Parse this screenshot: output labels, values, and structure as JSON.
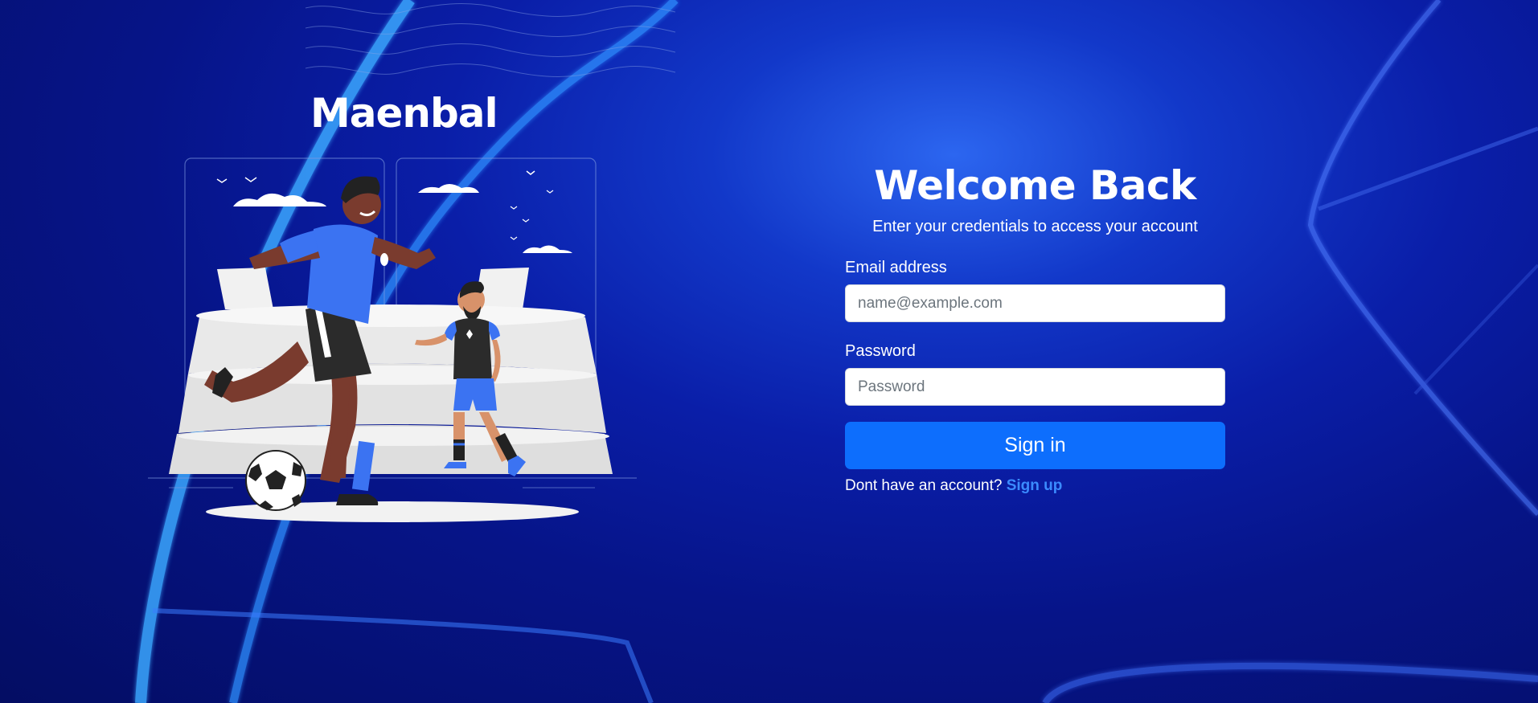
{
  "brand": {
    "name": "Maenbal"
  },
  "illustration": {
    "icon": "soccer-players-illustration"
  },
  "login": {
    "title": "Welcome Back",
    "subtitle": "Enter your credentials to access your account",
    "email_label": "Email address",
    "email_placeholder": "name@example.com",
    "email_value": "",
    "password_label": "Password",
    "password_placeholder": "Password",
    "password_value": "",
    "signin_label": "Sign in",
    "signup_prompt": "Dont have an account?",
    "signup_link": "Sign up"
  },
  "colors": {
    "background_dark": "#040d63",
    "background_mid": "#0a1ea8",
    "accent": "#0d6efd",
    "link": "#3b8bff",
    "text": "#ffffff"
  }
}
